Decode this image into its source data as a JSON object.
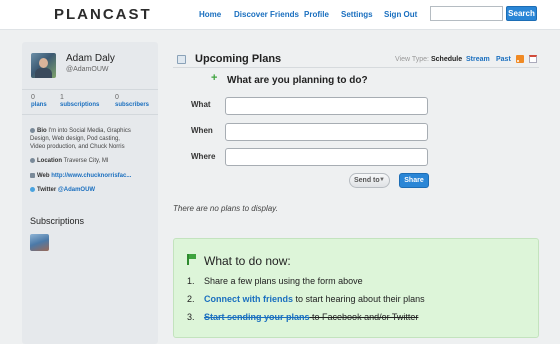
{
  "header": {
    "logo": "PLANCAST",
    "nav": [
      "Home",
      "Discover Friends",
      "Profile",
      "Settings",
      "Sign Out"
    ],
    "search_value": "",
    "search_button": "Search"
  },
  "profile": {
    "name": "Adam Daly",
    "handle": "@AdamOUW",
    "stats": [
      {
        "num": "0",
        "label": "plans"
      },
      {
        "num": "1",
        "label": "subscriptions"
      },
      {
        "num": "0",
        "label": "subscribers"
      }
    ],
    "bio_label": "Bio",
    "bio_line1": "I'm into Social Media, Graphics",
    "bio_line2": "Design, Web design, Pod casting,",
    "bio_line3": "Video production, and Chuck Norris",
    "location_label": "Location",
    "location": "Traverse City, MI",
    "web_label": "Web",
    "web": "http://www.chucknorrisfac...",
    "twitter_label": "Twitter",
    "twitter": "@AdamOUW"
  },
  "subscriptions": {
    "title": "Subscriptions"
  },
  "main": {
    "title": "Upcoming Plans",
    "view_type_label": "View Type:",
    "views": [
      "Schedule",
      "Stream",
      "Past"
    ],
    "form_question": "What are you planning to do?",
    "labels": [
      "What",
      "When",
      "Where"
    ],
    "send_to": "Send to",
    "share": "Share",
    "empty": "There are no plans to display."
  },
  "todo": {
    "title": "What to do now:",
    "items": [
      {
        "n": "1.",
        "link": "",
        "text": "Share a few plans using the form above"
      },
      {
        "n": "2.",
        "link": "Connect with friends",
        "text": " to start hearing about their plans"
      },
      {
        "n": "3.",
        "link": "Start sending your plans",
        "text": " to Facebook and/or Twitter"
      }
    ]
  },
  "colors": {
    "accent": "#1a6fbf",
    "button": "#2a86d6",
    "todo_bg": "#ddf5d9",
    "plus": "#3ea33e"
  }
}
